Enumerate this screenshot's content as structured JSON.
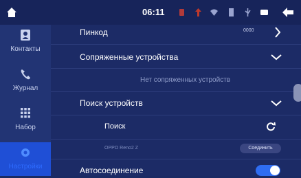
{
  "status_bar": {
    "time": "06:11",
    "icons": [
      "home-icon",
      "red-indicator-icon",
      "red-indicator-icon",
      "wifi-icon",
      "sd-card-icon",
      "usb-icon",
      "battery-icon",
      "back-icon"
    ]
  },
  "sidebar": {
    "items": [
      {
        "label": "Контакты",
        "icon": "contacts-icon",
        "active": false
      },
      {
        "label": "Журнал",
        "icon": "call-log-icon",
        "active": false
      },
      {
        "label": "Набор",
        "icon": "dialpad-icon",
        "active": false
      },
      {
        "label": "Настройки",
        "icon": "settings-icon",
        "active": true
      }
    ]
  },
  "settings": {
    "pin": {
      "label": "Пинкод",
      "value": "0000"
    },
    "paired": {
      "label": "Сопряженные устройства",
      "empty_text": "Нет сопряженных устройств"
    },
    "search_devices": {
      "label": "Поиск устройств"
    },
    "search": {
      "label": "Поиск"
    },
    "found_device": {
      "name": "OPPO Reno2 Z",
      "connect_label": "Соединить"
    },
    "autoconnect": {
      "label": "Автосоединение",
      "enabled": true
    }
  },
  "colors": {
    "accent": "#2f6df2",
    "background": "#1c2b66",
    "sidebar": "#223474",
    "active_nav": "#1f4fd6"
  }
}
